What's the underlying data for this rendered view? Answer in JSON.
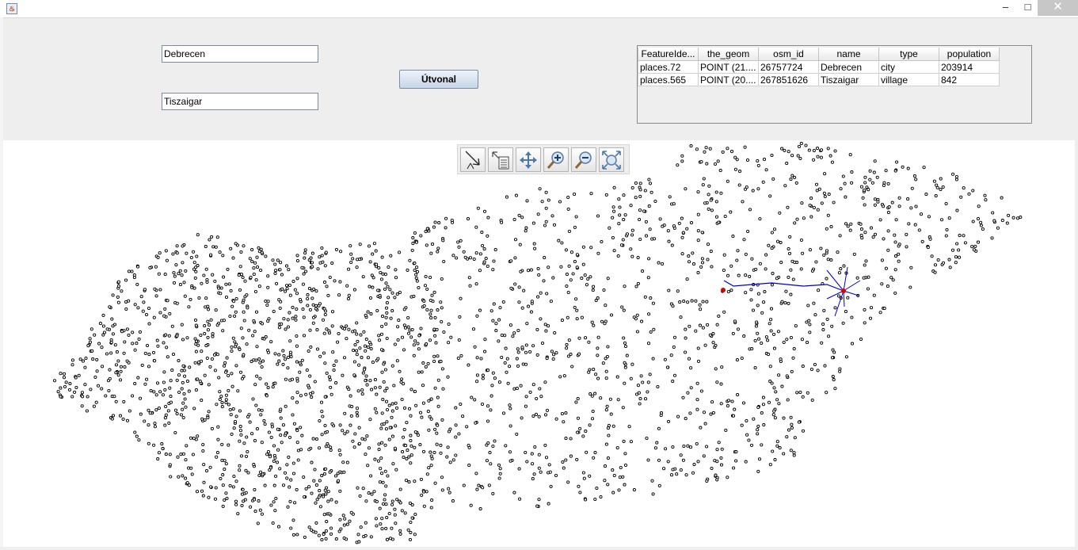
{
  "window": {
    "app_icon": "java-cup-icon",
    "minimize_glyph": "–",
    "maximize_glyph": "□",
    "close_glyph": "✕"
  },
  "form": {
    "from_value": "Debrecen",
    "to_value": "Tiszaigar",
    "route_button_label": "Útvonal"
  },
  "results_table": {
    "columns": [
      "FeatureIde...",
      "the_geom",
      "osm_id",
      "name",
      "type",
      "population"
    ],
    "rows": [
      [
        "places.72",
        "POINT (21....",
        "26757724",
        "Debrecen",
        "city",
        "203914"
      ],
      [
        "places.565",
        "POINT (20....",
        "267851626",
        "Tiszaigar",
        "village",
        "842"
      ]
    ]
  },
  "map_toolbar": {
    "tools": [
      "pointer-info-icon",
      "feature-info-icon",
      "pan-icon",
      "zoom-in-icon",
      "zoom-out-icon",
      "zoom-extent-icon"
    ]
  },
  "map": {
    "point_color": "#000000",
    "route_color": "#0000cc",
    "highlight_color": "#dd0000"
  }
}
